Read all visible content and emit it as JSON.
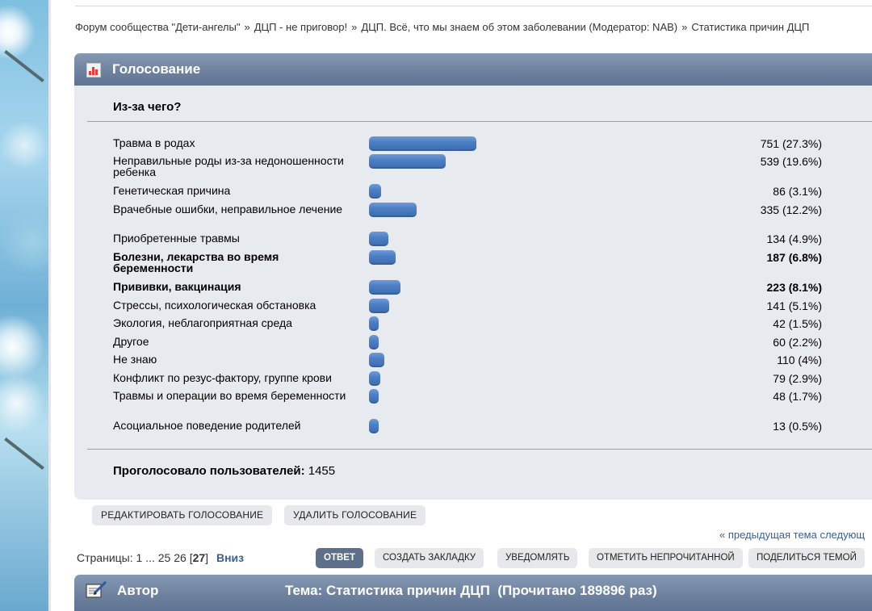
{
  "breadcrumb": {
    "items": [
      "Форум сообщества \"Дети-ангелы\"",
      "ДЦП - не приговор!",
      "ДЦП. Всё, что мы знаем об этом заболевании (Модератор: NAB)",
      "Статистика причин ДЦП"
    ],
    "separator": "»"
  },
  "poll": {
    "header_title": "Голосование",
    "question": "Из-за чего?",
    "options": [
      {
        "label": "Травма в родах",
        "count_text": "751 (27.3%)",
        "votes": 751,
        "percent": 27.3,
        "bold": false
      },
      {
        "label": "Неправильные роды из-за недоношенности ребенка",
        "count_text": "539 (19.6%)",
        "votes": 539,
        "percent": 19.6,
        "bold": false
      },
      {
        "label": "Генетическая причина",
        "count_text": "86 (3.1%)",
        "votes": 86,
        "percent": 3.1,
        "bold": false
      },
      {
        "label": "Врачебные ошибки, неправильное лечение",
        "count_text": "335 (12.2%)",
        "votes": 335,
        "percent": 12.2,
        "bold": false
      },
      {
        "label": "Приобретенные травмы",
        "count_text": "134 (4.9%)",
        "votes": 134,
        "percent": 4.9,
        "bold": false
      },
      {
        "label": "Болезни, лекарства во время беременности",
        "count_text": "187 (6.8%)",
        "votes": 187,
        "percent": 6.8,
        "bold": true
      },
      {
        "label": "Прививки, вакцинация",
        "count_text": "223 (8.1%)",
        "votes": 223,
        "percent": 8.1,
        "bold": true
      },
      {
        "label": "Стрессы, психологическая обстановка",
        "count_text": "141 (5.1%)",
        "votes": 141,
        "percent": 5.1,
        "bold": false
      },
      {
        "label": "Экология, неблагоприятная среда",
        "count_text": "42 (1.5%)",
        "votes": 42,
        "percent": 1.5,
        "bold": false
      },
      {
        "label": "Другое",
        "count_text": "60 (2.2%)",
        "votes": 60,
        "percent": 2.2,
        "bold": false
      },
      {
        "label": "Не знаю",
        "count_text": "110 (4%)",
        "votes": 110,
        "percent": 4,
        "bold": false
      },
      {
        "label": "Конфликт по резус-фактору, группе крови",
        "count_text": "79 (2.9%)",
        "votes": 79,
        "percent": 2.9,
        "bold": false
      },
      {
        "label": "Травмы и операции во время беременности",
        "count_text": "48 (1.7%)",
        "votes": 48,
        "percent": 1.7,
        "bold": false
      },
      {
        "label": "Асоциальное поведение родителей",
        "count_text": "13 (0.5%)",
        "votes": 13,
        "percent": 0.5,
        "bold": false
      }
    ],
    "voters_label": "Проголосовало пользователей:",
    "voters_count": "1455",
    "edit_button": "РЕДАКТИРОВАТЬ ГОЛОСОВАНИЕ",
    "delete_button": "УДАЛИТЬ ГОЛОСОВАНИЕ"
  },
  "nav": {
    "prev_next": "« предыдущая тема следующ"
  },
  "pagination": {
    "label": "Страницы:",
    "pages": [
      "1",
      "...",
      "25",
      "26"
    ],
    "current": "27",
    "down": "Вниз"
  },
  "actions": {
    "reply": "ОТВЕТ",
    "bookmark": "СОЗДАТЬ ЗАКЛАДКУ",
    "notify": "УВЕДОМЛЯТЬ",
    "mark_unread": "ОТМЕТИТЬ НЕПРОЧИТАННОЙ",
    "share": "ПОДЕЛИТЬСЯ ТЕМОЙ"
  },
  "topic_header": {
    "author_label": "Автор",
    "topic_title": "Тема: Статистика причин ДЦП  (Прочитано 189896 раз)"
  },
  "colors": {
    "header_bg": "#6e82a0",
    "poll_bg": "#e7eaef",
    "bar": "#4d7fc5",
    "primary_button": "#5e7089"
  },
  "icons": [
    "poll-chart-icon",
    "author-post-icon"
  ]
}
